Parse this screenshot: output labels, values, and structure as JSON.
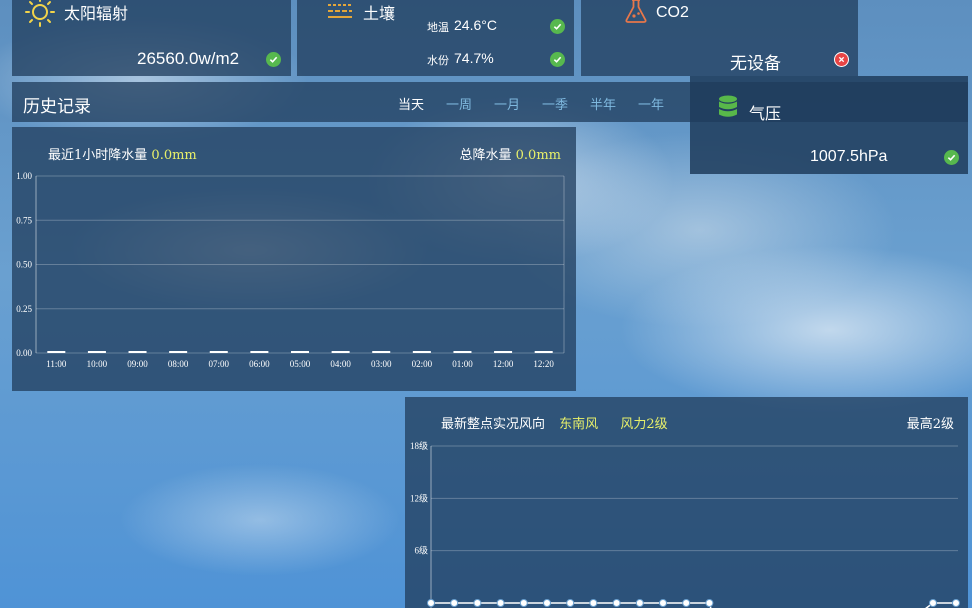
{
  "cards": {
    "solar": {
      "title": "太阳辐射",
      "value": "26560.0w/m2",
      "icon": "sun-icon",
      "status": "ok"
    },
    "soil": {
      "title": "土壤",
      "temp_label": "地温",
      "temp_value": "24.6°C",
      "moisture_label": "水份",
      "moisture_value": "74.7%",
      "icon": "soil-layers-icon"
    },
    "co2": {
      "title": "CO2",
      "value": "无设备",
      "icon": "flask-icon",
      "status": "error"
    },
    "pressure": {
      "title": "气压",
      "value": "1007.5hPa",
      "icon": "database-icon",
      "status": "ok"
    }
  },
  "history": {
    "title": "历史记录",
    "tabs": [
      "当天",
      "一周",
      "一月",
      "一季",
      "半年",
      "一年"
    ],
    "active_tab": 0
  },
  "rain": {
    "recent_label": "最近1小时降水量",
    "recent_value": "0.0mm",
    "total_label": "总降水量",
    "total_value": "0.0mm"
  },
  "wind": {
    "label": "最新整点实况风向",
    "direction": "东南风",
    "force": "风力2级",
    "max": "最高2级"
  },
  "colors": {
    "accent_yellow": "#e8f06a",
    "ok_green": "#57b84e",
    "error_red": "#e84545",
    "tab_blue": "#7fb9df"
  },
  "chart_data": [
    {
      "type": "bar",
      "categories": [
        "11:00",
        "10:00",
        "09:00",
        "08:00",
        "07:00",
        "06:00",
        "05:00",
        "04:00",
        "03:00",
        "02:00",
        "01:00",
        "12:00",
        "12:20"
      ],
      "values": [
        0,
        0,
        0,
        0,
        0,
        0,
        0,
        0,
        0,
        0,
        0,
        0,
        0
      ],
      "ylim": [
        0,
        1
      ],
      "yticks": [
        "0.00",
        "0.25",
        "0.50",
        "0.75",
        "1.00"
      ],
      "grid": true
    },
    {
      "type": "line",
      "yticks": [
        "6级",
        "12级",
        "18级"
      ],
      "ylim": [
        0,
        18
      ],
      "points": 15,
      "grid": true
    }
  ]
}
